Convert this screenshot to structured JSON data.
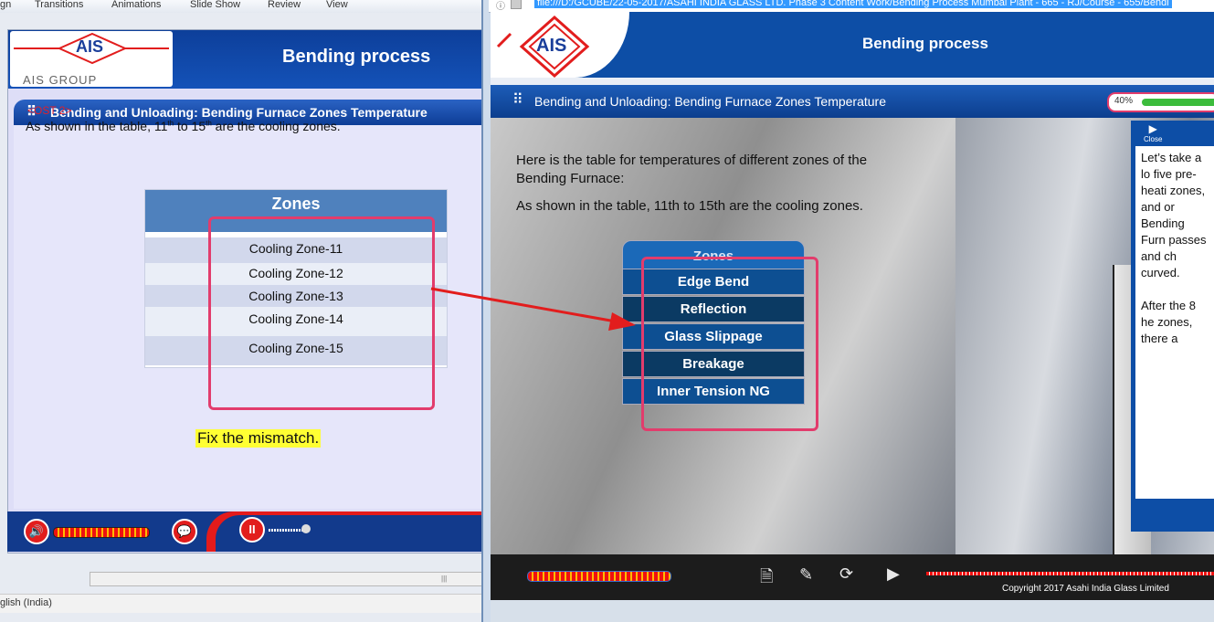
{
  "ribbon": {
    "tabs": [
      "gn",
      "Transitions",
      "Animations",
      "Slide Show",
      "Review",
      "View"
    ]
  },
  "editor_slide": {
    "logo_text": "AIS",
    "group_text": "AIS GROUP",
    "title": "Bending process",
    "subtitle": "Bending and Unloading: Bending Furnace Zones Temperature",
    "ost": "<OST 2>",
    "text_before": "As shown in the table, 11",
    "sup1": "th",
    "text_mid": " to 15",
    "sup2": "th",
    "text_after": " are the cooling zones.",
    "table_header": "Zones",
    "rows": [
      "Cooling Zone-11",
      "Cooling Zone-12",
      "Cooling Zone-13",
      "Cooling Zone-14",
      "Cooling Zone-15"
    ],
    "note": "Fix the mismatch.",
    "play_glyph": "II"
  },
  "status": {
    "language": "glish (India)"
  },
  "browser": {
    "address": "file:///D:/GCUBE/22-05-2017/ASAHI INDIA GLASS LTD. Phase 3 Content Work/Bending Process  Mumbai Plant - 665 - RJ/Course - 655/Bendi"
  },
  "player": {
    "logo_text": "AIS",
    "title": "Bending process",
    "subtitle": "Bending and Unloading: Bending Furnace Zones Temperature",
    "progress_label": "40%",
    "progress_value": 0.4,
    "text_line1": "Here is the table for temperatures of different zones of the Bending Furnace:",
    "text_line2": "As shown in the table, 11th to 15th are the cooling zones.",
    "menu_header": "Zones",
    "menu_items": [
      "Edge Bend",
      "Reflection",
      "Glass Slippage",
      "Breakage",
      "Inner Tension NG"
    ],
    "close_label": "Close",
    "panel_p1": "Let’s take a lo five pre-heati zones, and or Bending Furn passes and ch curved.",
    "panel_p2": "After the 8 he zones, there a",
    "copyright": "Copyright 2017 Asahi India Glass Limited"
  },
  "colors": {
    "brand_blue": "#0d4ea6",
    "brand_red": "#e21d1d",
    "highlight_pink": "#e23c6c",
    "note_yellow": "#ffff33"
  }
}
